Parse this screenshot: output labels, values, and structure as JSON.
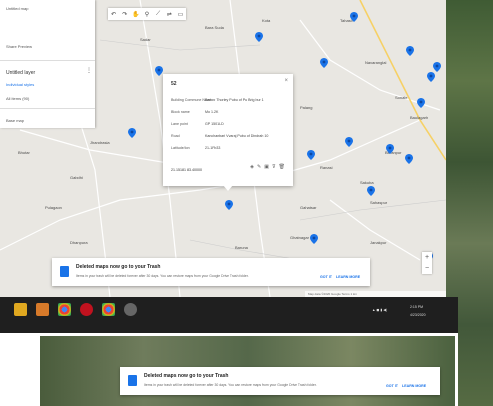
{
  "colors": {
    "map_bg": "#e9e7e2",
    "pin": "#1a73e8",
    "accent": "#1a73e8",
    "taskbar": "#1f1f1f"
  },
  "left_panel": {
    "line1": "Untitled map",
    "line2": "Share  Preview",
    "layer_title": "Untitled layer",
    "layer_sub": "Individual styles",
    "layer_count": "All items (90)",
    "base_map": "Base map"
  },
  "toolbar": {
    "icons": [
      "undo-icon",
      "redo-icon",
      "hand-icon",
      "marker-icon",
      "line-icon",
      "route-icon",
      "ruler-icon"
    ]
  },
  "info_window": {
    "title": "52",
    "rows": [
      {
        "key": "Building Commune Number",
        "value": "Ban ... Thorley Pubu of Pu Brig bur 1"
      },
      {
        "key": "Block name",
        "value": "Mo 1.2K"
      },
      {
        "key": "Lane point",
        "value": "GP 1501LD"
      },
      {
        "key": "Road",
        "value": "Kanchanbari Vvaraj Pubu of Dindrah 10"
      },
      {
        "key": "Latitude/lon",
        "value": "21-1Fb33"
      }
    ],
    "coords": "21.15181 83.40000",
    "actions": [
      "paint-icon",
      "edit-icon",
      "camera-icon",
      "filter-icon",
      "delete-icon"
    ]
  },
  "toast_main": {
    "title": "Deleted maps now go to your Trash",
    "body": "Items in your trash will be deleted forever after 30 days. You can restore maps from your Google Drive Trash folder.",
    "link1": "GOT IT",
    "link2": "LEARN MORE"
  },
  "toast_bottom": {
    "title": "Deleted maps now go to your Trash",
    "body": "Items in your trash will be deleted forever after 30 days. You can restore maps from your Google Drive Trash folder.",
    "link1": "GOT IT",
    "link2": "LEARN MORE"
  },
  "towns": [
    "Sadar",
    "Bara Suda",
    "Kota",
    "Tahasil",
    "Navaranglal",
    "Palang",
    "Sonale",
    "Baulagarh",
    "Jhandrasia",
    "Gabdhi",
    "Bhutar",
    "Pulagaon",
    "Dhanpura",
    "Ranasi",
    "Sakuba",
    "Sahaspur",
    "Gahatsar",
    "Ghatnagar",
    "Janakpur",
    "Baruna",
    "Beranpur"
  ],
  "footer": "Map data ©2020 Google  Terms  1 km",
  "taskbar": {
    "apps": [
      "file-explorer-icon",
      "files-icon",
      "chrome-icon",
      "opera-icon",
      "chrome-icon-2",
      "settings-icon"
    ],
    "time": "2:15 PM",
    "date": "4/23/2020"
  }
}
